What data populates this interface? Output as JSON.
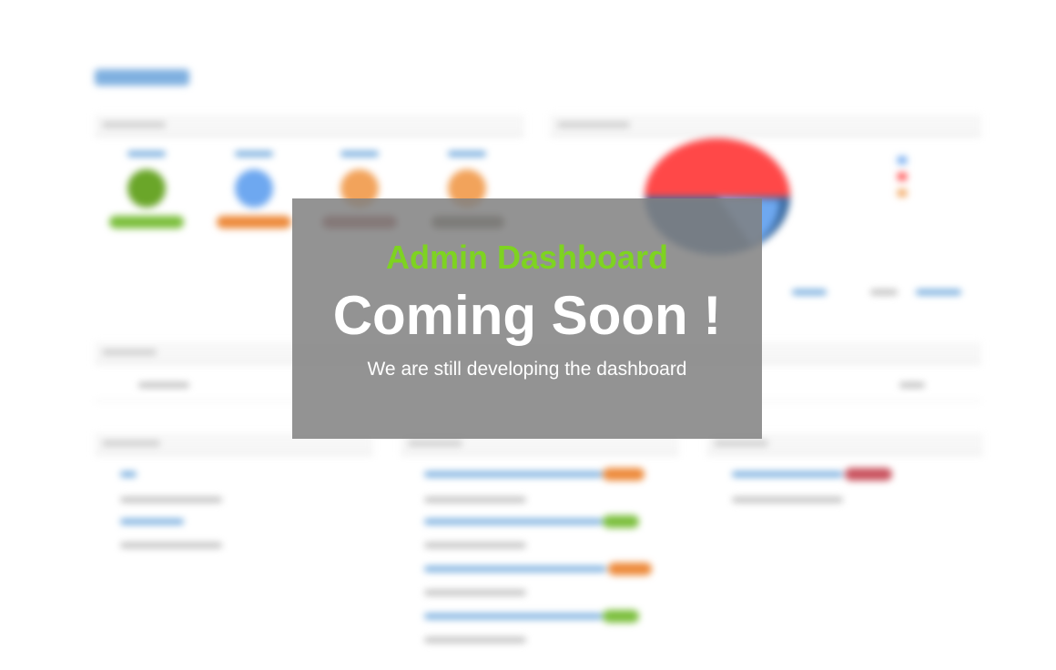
{
  "overlay": {
    "title": "Admin Dashboard",
    "heading": "Coming Soon !",
    "subtitle": "We are still developing the dashboard"
  },
  "colors": {
    "accent_green": "#7ed321",
    "overlay_bg": "#808080",
    "link_blue": "#6fa8dc",
    "red": "#ff4444",
    "dark_blue": "#3d6da3",
    "orange": "#ed8a3b"
  }
}
